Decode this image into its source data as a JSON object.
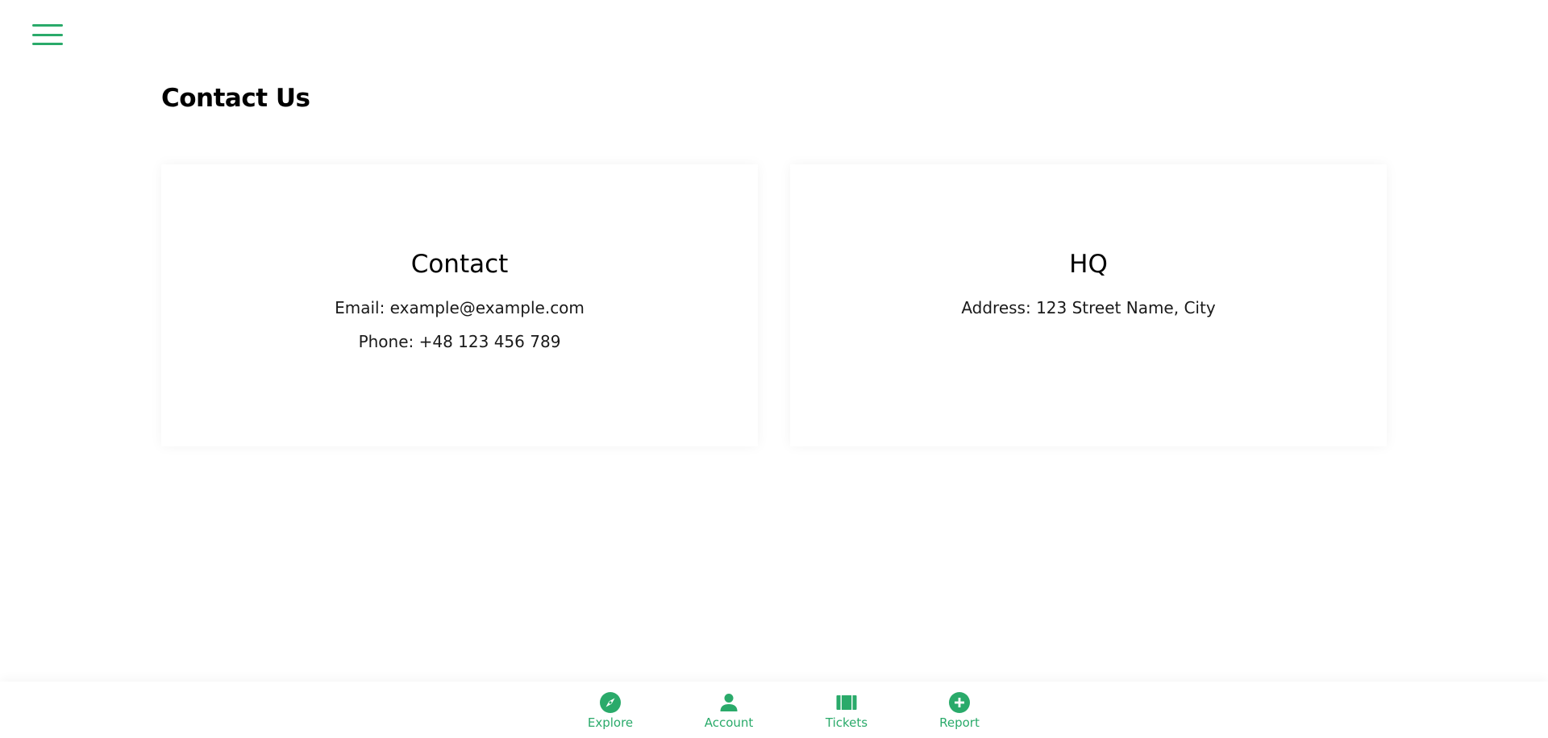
{
  "colors": {
    "accent": "#2aaa6a"
  },
  "menu": {
    "icon": "hamburger-icon"
  },
  "page": {
    "title": "Contact Us"
  },
  "cards": {
    "contact": {
      "title": "Contact",
      "email": "Email: example@example.com",
      "phone": "Phone: +48 123 456 789"
    },
    "hq": {
      "title": "HQ",
      "address": "Address: 123 Street Name, City"
    }
  },
  "nav": {
    "items": [
      {
        "label": "Explore",
        "icon": "compass-icon"
      },
      {
        "label": "Account",
        "icon": "person-icon"
      },
      {
        "label": "Tickets",
        "icon": "ticket-icon"
      },
      {
        "label": "Report",
        "icon": "plus-circle-icon"
      }
    ]
  }
}
